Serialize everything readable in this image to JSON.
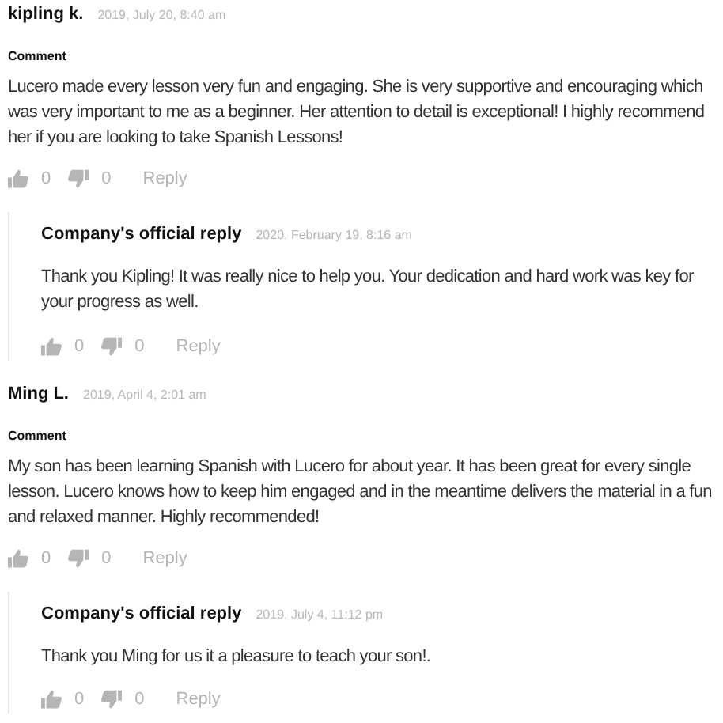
{
  "comments": [
    {
      "author": "kipling k.",
      "date": "2019, July 20, 8:40 am",
      "label": "Comment",
      "text": "Lucero made every lesson very fun and engaging. She is very supportive and encouraging which was very important to me as a beginner. Her attention to detail is exceptional! I highly recommend her if you are looking to take Spanish Lessons!",
      "likes": "0",
      "dislikes": "0",
      "reply_link": "Reply",
      "official_reply": {
        "author": "Company's official reply",
        "date": "2020, February 19, 8:16 am",
        "text": "Thank you Kipling! It was really nice to help you. Your dedication and hard work was key for your progress as well.",
        "likes": "0",
        "dislikes": "0",
        "reply_link": "Reply"
      }
    },
    {
      "author": "Ming L.",
      "date": "2019, April 4, 2:01 am",
      "label": "Comment",
      "text": "My son has been learning Spanish with Lucero for about year. It has been great for every single lesson. Lucero knows how to keep him engaged and in the meantime delivers the material in a fun and relaxed manner. Highly recommended!",
      "likes": "0",
      "dislikes": "0",
      "reply_link": "Reply",
      "official_reply": {
        "author": "Company's official reply",
        "date": "2019, July 4, 11:12 pm",
        "text": "Thank you Ming for us it a pleasure to teach your son!.",
        "likes": "0",
        "dislikes": "0",
        "reply_link": "Reply"
      }
    }
  ]
}
